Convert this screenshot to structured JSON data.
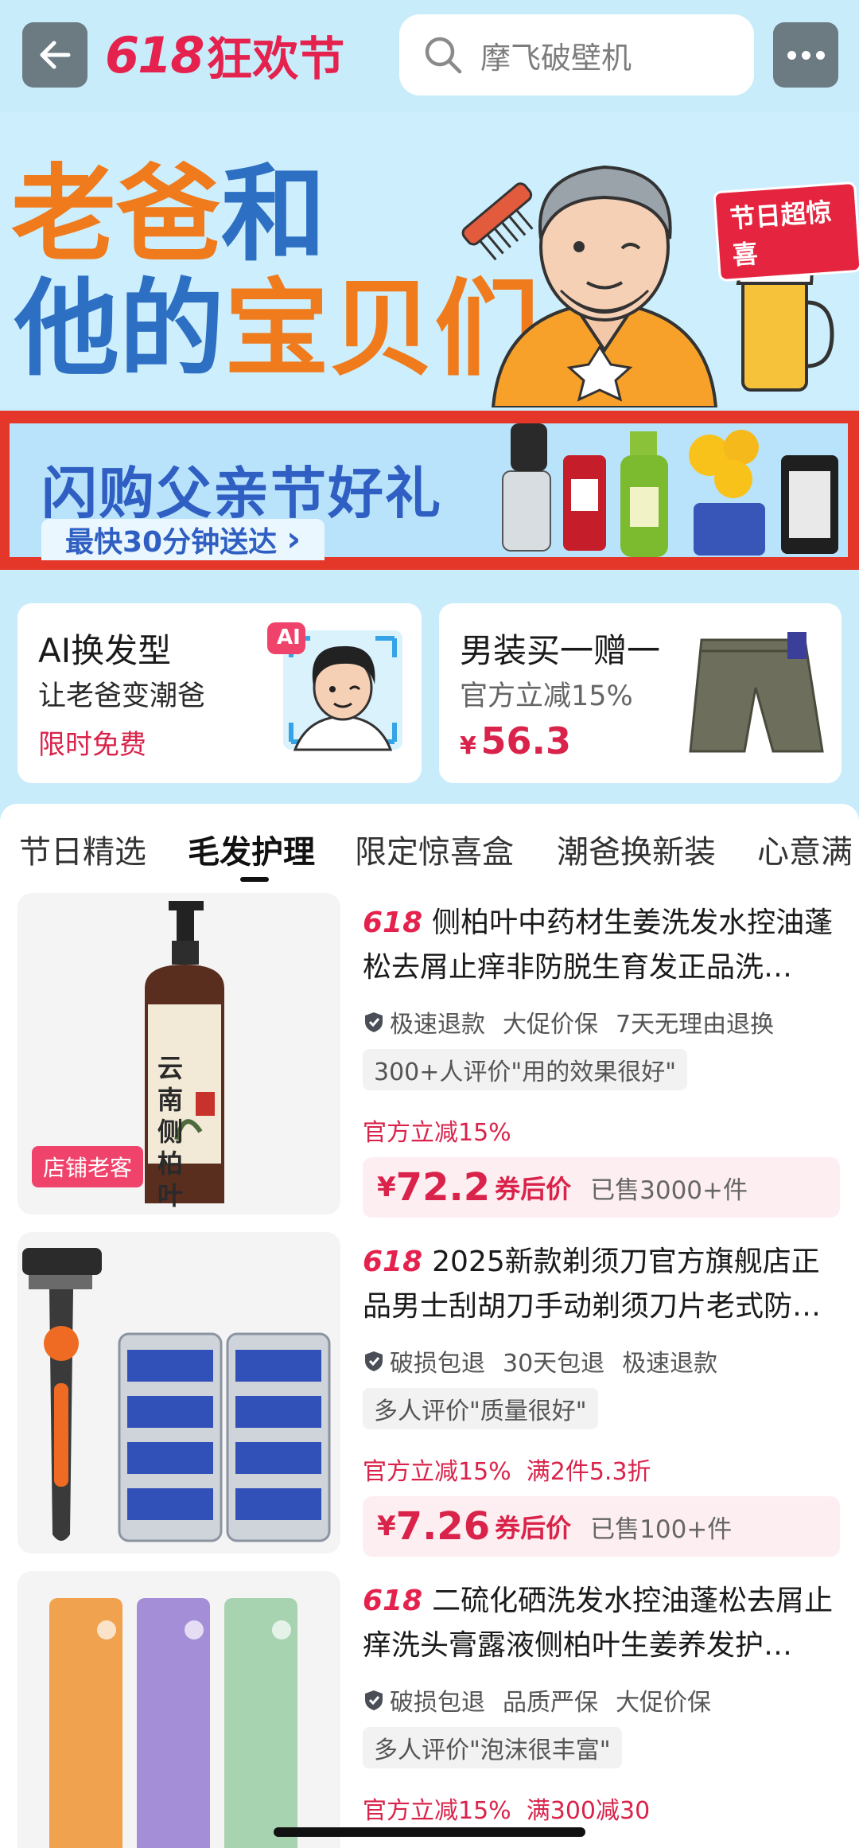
{
  "header": {
    "back_icon": "arrow-left-icon",
    "brand_number": "618",
    "brand_text": "狂欢节",
    "search_placeholder": "摩飞破壁机",
    "more_icon": "more-dots-icon"
  },
  "hero": {
    "line1_a": "老爸",
    "line1_b": "和",
    "line2_a": "他的",
    "line2_b": "宝贝们",
    "badge": "节日超惊喜"
  },
  "flash_banner": {
    "title": "闪购父亲节好礼",
    "subtitle": "最快30分钟送达",
    "chevron": "›"
  },
  "promo_cards": [
    {
      "title": "AI换发型",
      "subtitle": "让老爸变潮爸",
      "tag": "限时免费",
      "image_badge": "AI"
    },
    {
      "title": "男装买一赠一",
      "subtitle": "官方立减15%",
      "price_currency": "¥",
      "price": "56.3"
    }
  ],
  "tabs": [
    {
      "label": "节日精选",
      "active": false
    },
    {
      "label": "毛发护理",
      "active": true
    },
    {
      "label": "限定惊喜盒",
      "active": false
    },
    {
      "label": "潮爸换新装",
      "active": false
    },
    {
      "label": "心意满",
      "active": false
    }
  ],
  "products": [
    {
      "tag": "618",
      "title": "侧柏叶中药材生姜洗发水控油蓬松去屑止痒非防脱生育发正品洗…",
      "services": [
        "极速退款",
        "大促价保",
        "7天无理由退换"
      ],
      "review": "300+人评价\"用的效果很好\"",
      "discount": "官方立减15%",
      "currency": "¥",
      "price": "72.2",
      "price_label": "券后价",
      "sold": "已售3000+件",
      "image_badge": "店铺老客",
      "image_label": "云南侧柏叶"
    },
    {
      "tag": "618",
      "title": "2025新款剃须刀官方旗舰店正品男士刮胡刀手动剃须刀片老式防…",
      "services": [
        "破损包退",
        "30天包退",
        "极速退款"
      ],
      "review": "多人评价\"质量很好\"",
      "discount": "官方立减15%  满2件5.3折",
      "currency": "¥",
      "price": "7.26",
      "price_label": "券后价",
      "sold": "已售100+件"
    },
    {
      "tag": "618",
      "title": "二硫化硒洗发水控油蓬松去屑止痒洗头膏露液侧柏叶生姜养发护…",
      "services": [
        "破损包退",
        "品质严保",
        "大促价保"
      ],
      "review": "多人评价\"泡沫很丰富\"",
      "discount": "官方立减15%  满300减30"
    }
  ],
  "colors": {
    "accent_red": "#e4224d",
    "sky_bg": "#c9ecfb",
    "banner_blue": "#2f5fc2",
    "hero_orange": "#f07b1d"
  }
}
